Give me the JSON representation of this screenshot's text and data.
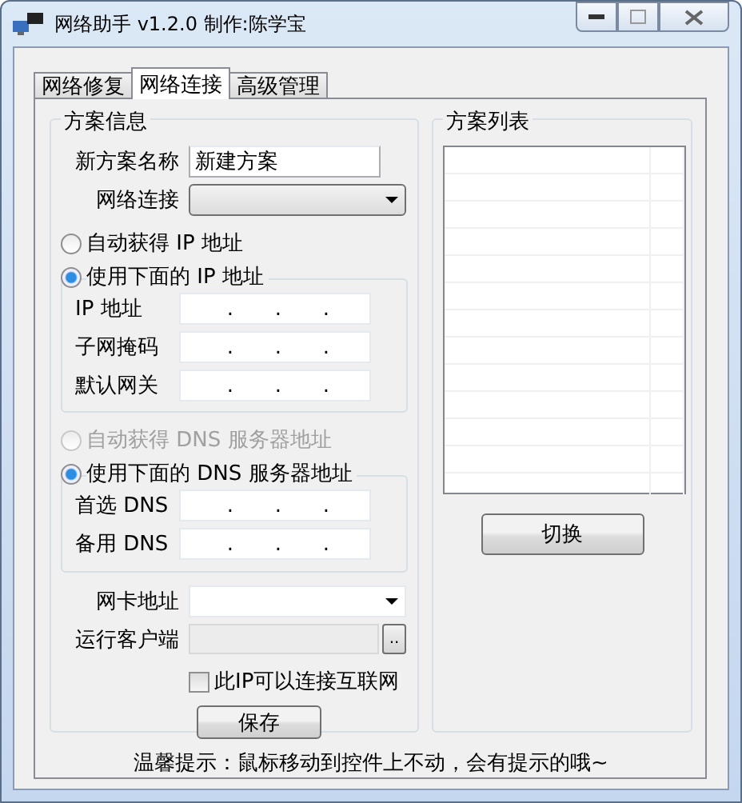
{
  "window": {
    "title": "网络助手 v1.2.0 制作:陈学宝"
  },
  "tabs": [
    {
      "label": "网络修复",
      "selected": false
    },
    {
      "label": "网络连接",
      "selected": true
    },
    {
      "label": "高级管理",
      "selected": false
    }
  ],
  "scheme_info": {
    "title": "方案信息",
    "name_label": "新方案名称",
    "name_value": "新建方案",
    "connection_label": "网络连接",
    "ip_radios": [
      {
        "label": "自动获得 IP 地址",
        "selected": false,
        "disabled": false
      },
      {
        "label": "使用下面的 IP 地址",
        "selected": true,
        "disabled": false
      }
    ],
    "ip_fields": [
      {
        "label": "IP 地址",
        "separators": [
          ".",
          ".",
          "."
        ]
      },
      {
        "label": "子网掩码",
        "separators": [
          ".",
          ".",
          "."
        ]
      },
      {
        "label": "默认网关",
        "separators": [
          ".",
          ".",
          "."
        ]
      }
    ],
    "dns_radios": [
      {
        "label": "自动获得 DNS 服务器地址",
        "selected": false,
        "disabled": true
      },
      {
        "label": "使用下面的 DNS 服务器地址",
        "selected": true,
        "disabled": false
      }
    ],
    "dns_fields": [
      {
        "label": "首选 DNS",
        "separators": [
          ".",
          ".",
          "."
        ]
      },
      {
        "label": "备用 DNS",
        "separators": [
          ".",
          ".",
          "."
        ]
      }
    ],
    "mac_label": "网卡地址",
    "client_label": "运行客户端",
    "browse_button": "..",
    "internet_checkbox": {
      "label": "此IP可以连接互联网",
      "checked": false
    },
    "save_button": "保存"
  },
  "scheme_list": {
    "title": "方案列表",
    "switch_button": "切换"
  },
  "hint": "温馨提示：鼠标移动到控件上不动，会有提示的哦~"
}
